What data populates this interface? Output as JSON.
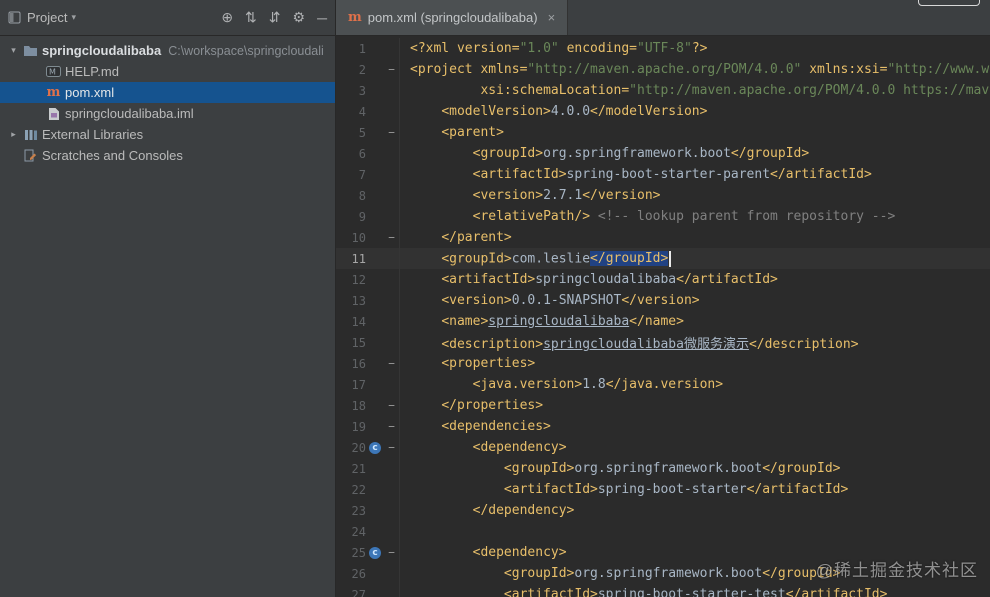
{
  "watermark": "@稀土掘金技术社区",
  "colors": {
    "tag": "#e8bf6a",
    "string": "#6a8759",
    "comment": "#808080",
    "plain_text": "#a9b7c6",
    "editor_selection": "#214283",
    "tree_selection": "#15538f",
    "maven_orange": "#e0714a",
    "editor_bg": "#2b2b2b",
    "panel_bg": "#3c3f41"
  },
  "icons": {
    "maven_glyph": "m",
    "chevron_down": "▾"
  },
  "topbar": {
    "project_label": "Project",
    "icons": [
      {
        "name": "locate-file",
        "glyph": "⊕"
      },
      {
        "name": "collapse-all",
        "glyph": "⇅"
      },
      {
        "name": "expand-all",
        "glyph": "⇵"
      },
      {
        "name": "settings-gear",
        "glyph": "⚙"
      },
      {
        "name": "hide-panel",
        "glyph": "─"
      }
    ]
  },
  "tab": {
    "title": "pom.xml (springcloudalibaba)",
    "close_glyph": "×"
  },
  "project_tree": {
    "items": [
      {
        "id": "root-springcloudalibaba",
        "depth": 0,
        "chevron": "▾",
        "icon": "folder",
        "label": "springcloudalibaba",
        "path": "C:\\workspace\\springcloudali",
        "bold": true
      },
      {
        "id": "help-md",
        "depth": 1,
        "icon": "markdown",
        "label": "HELP.md"
      },
      {
        "id": "pom-xml",
        "depth": 1,
        "icon": "maven",
        "label": "pom.xml",
        "selected": true
      },
      {
        "id": "springcloudalibaba-iml",
        "depth": 1,
        "icon": "iml",
        "label": "springcloudalibaba.iml"
      },
      {
        "id": "external-libraries",
        "depth": 0,
        "chevron": "▸",
        "icon": "libraries",
        "label": "External Libraries"
      },
      {
        "id": "scratches-and-consoles",
        "depth": 0,
        "icon": "scratches",
        "label": "Scratches and Consoles"
      }
    ]
  },
  "editor": {
    "lines": [
      {
        "n": 1,
        "seg": [
          {
            "t": "<?xml ",
            "c": "tag"
          },
          {
            "t": "version=",
            "c": "attr"
          },
          {
            "t": "\"1.0\"",
            "c": "str"
          },
          {
            "t": " ",
            "c": "pln"
          },
          {
            "t": "encoding=",
            "c": "attr"
          },
          {
            "t": "\"UTF-8\"",
            "c": "str"
          },
          {
            "t": "?>",
            "c": "tag"
          }
        ]
      },
      {
        "n": 2,
        "fold": true,
        "seg": [
          {
            "t": "<project ",
            "c": "tag"
          },
          {
            "t": "xmlns=",
            "c": "attr"
          },
          {
            "t": "\"http://maven.apache.org/POM/4.0.0\"",
            "c": "str"
          },
          {
            "t": " ",
            "c": "pln"
          },
          {
            "t": "xmlns:xsi=",
            "c": "attr"
          },
          {
            "t": "\"http://www.w",
            "c": "str"
          }
        ]
      },
      {
        "n": 3,
        "seg": [
          {
            "t": "         ",
            "c": "pln"
          },
          {
            "t": "xsi:schemaLocation=",
            "c": "attr"
          },
          {
            "t": "\"http://maven.apache.org/POM/4.0.0 https://mav",
            "c": "str"
          }
        ]
      },
      {
        "n": 4,
        "seg": [
          {
            "t": "    ",
            "c": "pln"
          },
          {
            "t": "<modelVersion>",
            "c": "tag"
          },
          {
            "t": "4.0.0",
            "c": "pln"
          },
          {
            "t": "</modelVersion>",
            "c": "tag"
          }
        ]
      },
      {
        "n": 5,
        "fold": true,
        "seg": [
          {
            "t": "    ",
            "c": "pln"
          },
          {
            "t": "<parent>",
            "c": "tag"
          }
        ]
      },
      {
        "n": 6,
        "seg": [
          {
            "t": "        ",
            "c": "pln"
          },
          {
            "t": "<groupId>",
            "c": "tag"
          },
          {
            "t": "org.springframework.boot",
            "c": "pln"
          },
          {
            "t": "</groupId>",
            "c": "tag"
          }
        ]
      },
      {
        "n": 7,
        "seg": [
          {
            "t": "        ",
            "c": "pln"
          },
          {
            "t": "<artifactId>",
            "c": "tag"
          },
          {
            "t": "spring-boot-starter-parent",
            "c": "pln"
          },
          {
            "t": "</artifactId>",
            "c": "tag"
          }
        ]
      },
      {
        "n": 8,
        "seg": [
          {
            "t": "        ",
            "c": "pln"
          },
          {
            "t": "<version>",
            "c": "tag"
          },
          {
            "t": "2.7.1",
            "c": "pln"
          },
          {
            "t": "</version>",
            "c": "tag"
          }
        ]
      },
      {
        "n": 9,
        "seg": [
          {
            "t": "        ",
            "c": "pln"
          },
          {
            "t": "<relativePath/>",
            "c": "tag"
          },
          {
            "t": " ",
            "c": "pln"
          },
          {
            "t": "<!-- lookup parent from repository -->",
            "c": "cmt"
          }
        ]
      },
      {
        "n": 10,
        "fold": true,
        "seg": [
          {
            "t": "    ",
            "c": "pln"
          },
          {
            "t": "</parent>",
            "c": "tag"
          }
        ]
      },
      {
        "n": 11,
        "cur": true,
        "seg": [
          {
            "t": "    ",
            "c": "pln"
          },
          {
            "t": "<groupId>",
            "c": "tag"
          },
          {
            "t": "com.leslie",
            "c": "pln"
          },
          {
            "t": "</groupId>",
            "c": "tag",
            "sel": true,
            "caret": true
          }
        ]
      },
      {
        "n": 12,
        "seg": [
          {
            "t": "    ",
            "c": "pln"
          },
          {
            "t": "<artifactId>",
            "c": "tag"
          },
          {
            "t": "springcloudalibaba",
            "c": "pln"
          },
          {
            "t": "</artifactId>",
            "c": "tag"
          }
        ]
      },
      {
        "n": 13,
        "seg": [
          {
            "t": "    ",
            "c": "pln"
          },
          {
            "t": "<version>",
            "c": "tag"
          },
          {
            "t": "0.0.1-SNAPSHOT",
            "c": "pln"
          },
          {
            "t": "</version>",
            "c": "tag"
          }
        ]
      },
      {
        "n": 14,
        "seg": [
          {
            "t": "    ",
            "c": "pln"
          },
          {
            "t": "<name>",
            "c": "tag"
          },
          {
            "t": "springcloudalibaba",
            "c": "pln",
            "u": true
          },
          {
            "t": "</name>",
            "c": "tag"
          }
        ]
      },
      {
        "n": 15,
        "seg": [
          {
            "t": "    ",
            "c": "pln"
          },
          {
            "t": "<description>",
            "c": "tag"
          },
          {
            "t": "springcloudalibaba微服务演示",
            "c": "pln",
            "u": true
          },
          {
            "t": "</description>",
            "c": "tag"
          }
        ]
      },
      {
        "n": 16,
        "fold": true,
        "seg": [
          {
            "t": "    ",
            "c": "pln"
          },
          {
            "t": "<properties>",
            "c": "tag"
          }
        ]
      },
      {
        "n": 17,
        "seg": [
          {
            "t": "        ",
            "c": "pln"
          },
          {
            "t": "<java.version>",
            "c": "tag"
          },
          {
            "t": "1.8",
            "c": "pln"
          },
          {
            "t": "</java.version>",
            "c": "tag"
          }
        ]
      },
      {
        "n": 18,
        "fold": true,
        "seg": [
          {
            "t": "    ",
            "c": "pln"
          },
          {
            "t": "</properties>",
            "c": "tag"
          }
        ]
      },
      {
        "n": 19,
        "fold": true,
        "seg": [
          {
            "t": "    ",
            "c": "pln"
          },
          {
            "t": "<dependencies>",
            "c": "tag"
          }
        ]
      },
      {
        "n": 20,
        "fold": true,
        "icon": "dep",
        "seg": [
          {
            "t": "        ",
            "c": "pln"
          },
          {
            "t": "<dependency>",
            "c": "tag"
          }
        ]
      },
      {
        "n": 21,
        "seg": [
          {
            "t": "            ",
            "c": "pln"
          },
          {
            "t": "<groupId>",
            "c": "tag"
          },
          {
            "t": "org.springframework.boot",
            "c": "pln"
          },
          {
            "t": "</groupId>",
            "c": "tag"
          }
        ]
      },
      {
        "n": 22,
        "seg": [
          {
            "t": "            ",
            "c": "pln"
          },
          {
            "t": "<artifactId>",
            "c": "tag"
          },
          {
            "t": "spring-boot-starter",
            "c": "pln"
          },
          {
            "t": "</artifactId>",
            "c": "tag"
          }
        ]
      },
      {
        "n": 23,
        "seg": [
          {
            "t": "        ",
            "c": "pln"
          },
          {
            "t": "</dependency>",
            "c": "tag"
          }
        ]
      },
      {
        "n": 24,
        "seg": []
      },
      {
        "n": 25,
        "fold": true,
        "icon": "dep",
        "seg": [
          {
            "t": "        ",
            "c": "pln"
          },
          {
            "t": "<dependency>",
            "c": "tag"
          }
        ]
      },
      {
        "n": 26,
        "seg": [
          {
            "t": "            ",
            "c": "pln"
          },
          {
            "t": "<groupId>",
            "c": "tag"
          },
          {
            "t": "org.springframework.boot",
            "c": "pln"
          },
          {
            "t": "</groupId>",
            "c": "tag"
          }
        ]
      },
      {
        "n": 27,
        "seg": [
          {
            "t": "            ",
            "c": "pln"
          },
          {
            "t": "<artifactId>",
            "c": "tag"
          },
          {
            "t": "spring-boot-starter-test",
            "c": "pln"
          },
          {
            "t": "</artifactId>",
            "c": "tag"
          }
        ]
      }
    ]
  }
}
